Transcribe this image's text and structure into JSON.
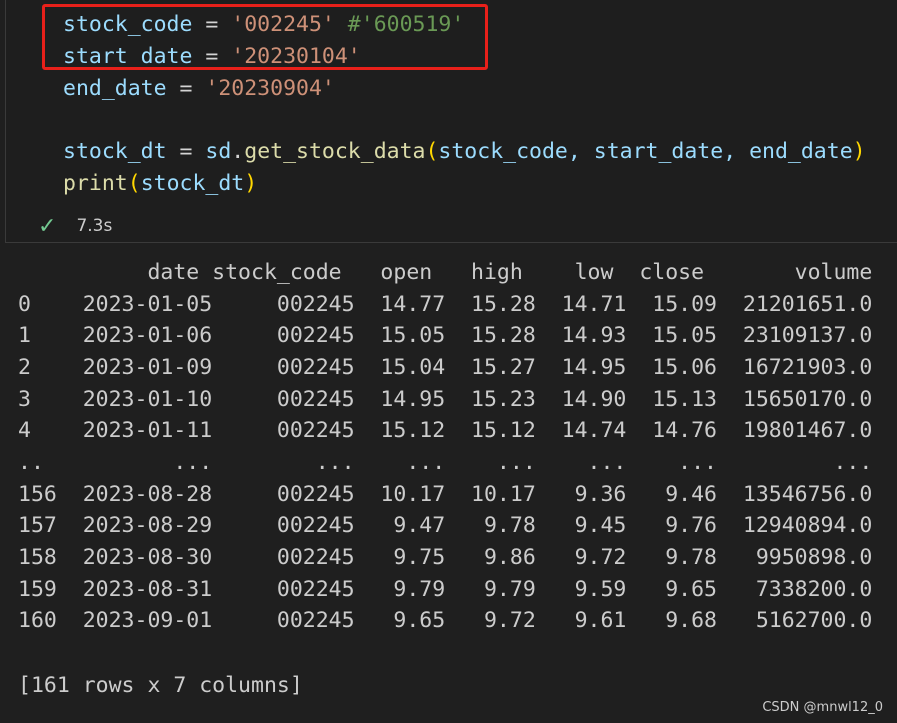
{
  "code": {
    "line1": {
      "var": "stock_code",
      "op": " = ",
      "value": "'002245'",
      "comment": " #'600519'"
    },
    "line2": {
      "var": "start_date",
      "op": " = ",
      "value": "'20230104'"
    },
    "line3": {
      "var": "end_date",
      "op": " = ",
      "value": "'20230904'"
    },
    "line4": {
      "var": "stock_dt",
      "op": " = ",
      "module": "sd",
      "dot": ".",
      "func": "get_stock_data",
      "open": "(",
      "args": "stock_code, start_date, end_date",
      "close": ")"
    },
    "line5": {
      "func": "print",
      "open": "(",
      "args": "stock_dt",
      "close": ")"
    }
  },
  "status": {
    "time": "7.3s"
  },
  "output": {
    "header": "          date stock_code   open   high    low  close       volume",
    "rows": [
      "0    2023-01-05     002245  14.77  15.28  14.71  15.09  21201651.0",
      "1    2023-01-06     002245  15.05  15.28  14.93  15.05  23109137.0",
      "2    2023-01-09     002245  15.04  15.27  14.95  15.06  16721903.0",
      "3    2023-01-10     002245  14.95  15.23  14.90  15.13  15650170.0",
      "4    2023-01-11     002245  15.12  15.12  14.74  14.76  19801467.0",
      "..          ...        ...    ...    ...    ...    ...         ...",
      "156  2023-08-28     002245  10.17  10.17   9.36   9.46  13546756.0",
      "157  2023-08-29     002245   9.47   9.78   9.45   9.76  12940894.0",
      "158  2023-08-30     002245   9.75   9.86   9.72   9.78   9950898.0",
      "159  2023-08-31     002245   9.79   9.79   9.59   9.65   7338200.0",
      "160  2023-09-01     002245   9.65   9.72   9.61   9.68   5162700.0"
    ],
    "summary": "[161 rows x 7 columns]"
  },
  "watermark": "CSDN @mnwl12_0",
  "colors": {
    "highlight": "#e8201a",
    "check": "#73c991"
  },
  "icons": {
    "status": "check-icon"
  }
}
